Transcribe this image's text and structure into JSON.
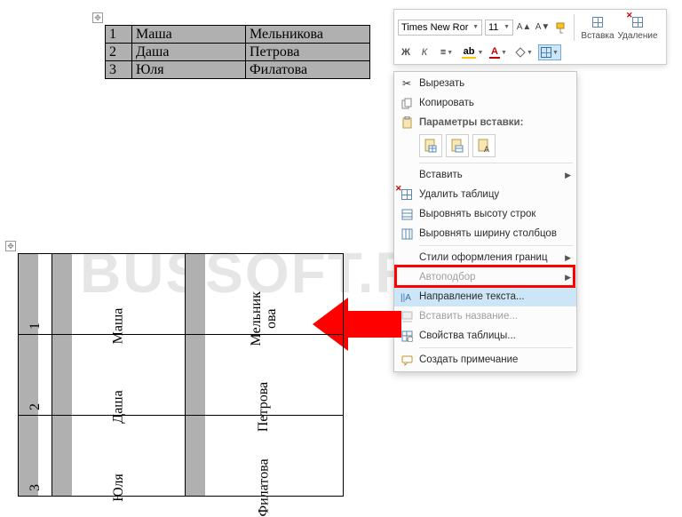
{
  "watermark": "BUSSOFT.RU",
  "toolbar": {
    "font_name": "Times New Ror",
    "font_size": "11",
    "bold": "Ж",
    "italic": "К",
    "insert_label": "Вставка",
    "delete_label": "Удаление"
  },
  "top_table": {
    "rows": [
      {
        "idx": "1",
        "name": "Маша",
        "last": "Мельникова"
      },
      {
        "idx": "2",
        "name": "Даша",
        "last": "Петрова"
      },
      {
        "idx": "3",
        "name": "Юля",
        "last": "Филатова"
      }
    ]
  },
  "bot_table": {
    "rows": [
      {
        "idx": "1",
        "name": "Маша",
        "last": "Мельник\nова"
      },
      {
        "idx": "2",
        "name": "Даша",
        "last": "Петрова"
      },
      {
        "idx": "3",
        "name": "Юля",
        "last": "Филатова"
      }
    ]
  },
  "ctx": {
    "cut": "Вырезать",
    "copy": "Копировать",
    "paste_header": "Параметры вставки:",
    "insert": "Вставить",
    "delete_table": "Удалить таблицу",
    "dist_rows": "Выровнять высоту строк",
    "dist_cols": "Выровнять ширину столбцов",
    "border_styles": "Стили оформления границ",
    "autofit": "Автоподбор",
    "text_direction": "Направление текста...",
    "insert_caption": "Вставить название...",
    "table_props": "Свойства таблицы...",
    "new_comment": "Создать примечание"
  }
}
